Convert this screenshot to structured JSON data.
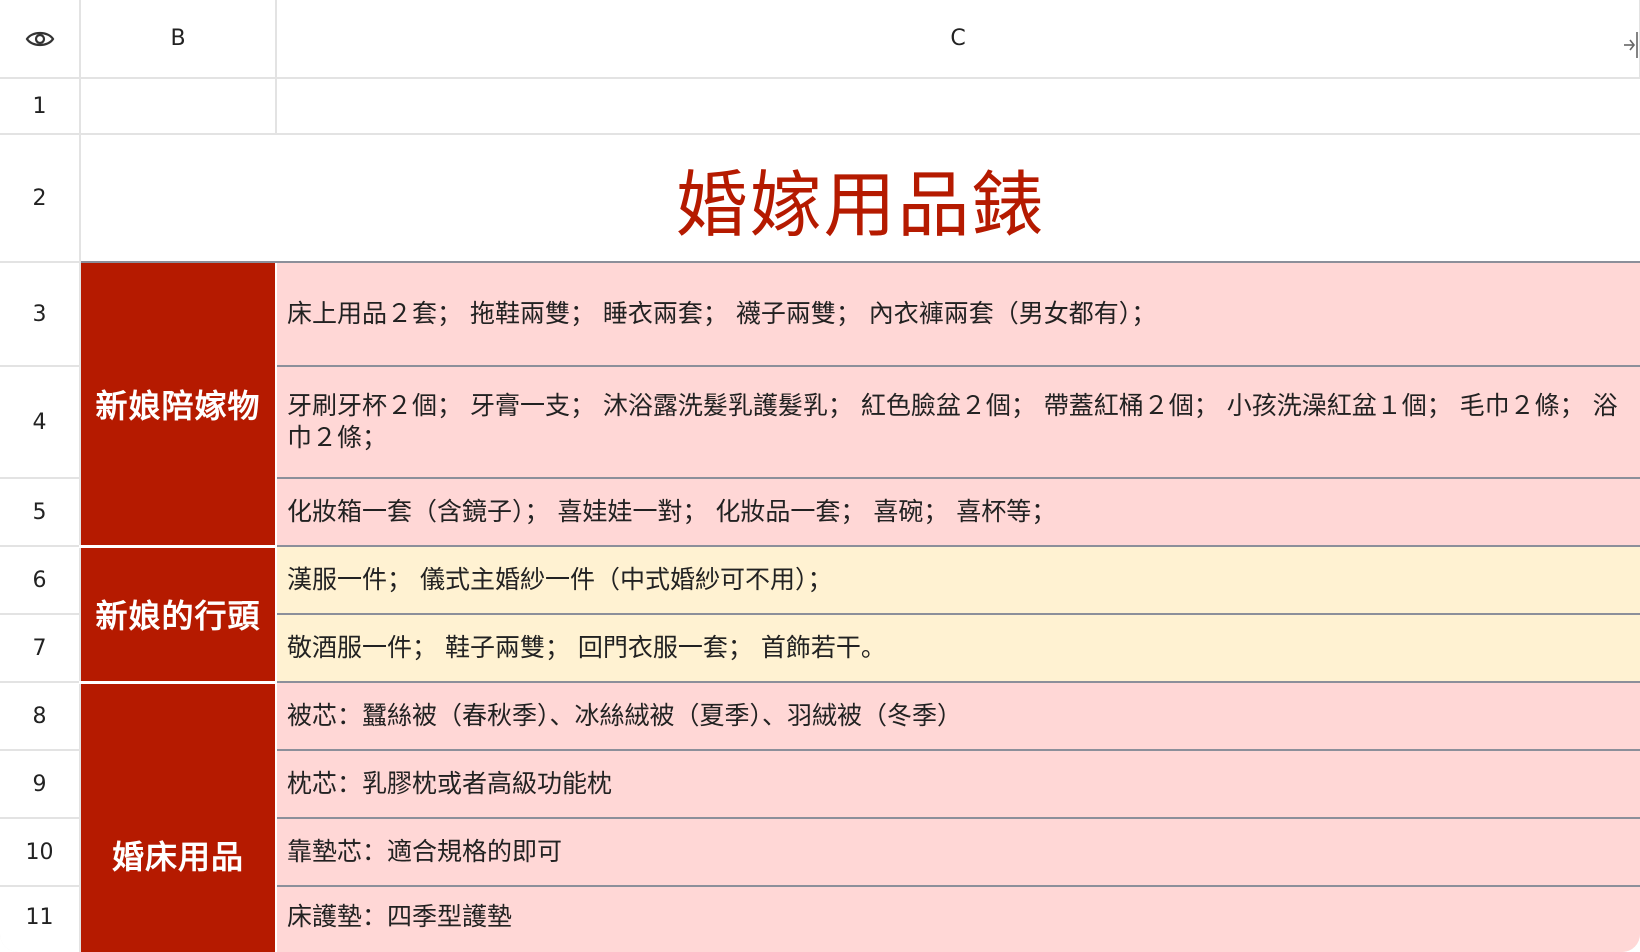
{
  "columns": {
    "corner_icon": "eye-icon",
    "b": "B",
    "c": "C",
    "collapse_icon": "panel-collapse-icon"
  },
  "rows": {
    "r1": "1",
    "r2": "2",
    "r3": "3",
    "r4": "4",
    "r5": "5",
    "r6": "6",
    "r7": "7",
    "r8": "8",
    "r9": "9",
    "r10": "10",
    "r11": "11"
  },
  "title": "婚嫁用品錶",
  "categories": {
    "bride_dowry": "新娘陪嫁物",
    "bride_outfits": "新娘的行頭",
    "wedding_bed": "婚床用品"
  },
  "items": {
    "r3": "床上用品２套；  拖鞋兩雙；  睡衣兩套；  襪子兩雙；  內衣褲兩套（男女都有）；",
    "r4": "牙刷牙杯２個；  牙膏一支；  沐浴露洗髮乳護髮乳；  紅色臉盆２個；  帶蓋紅桶２個；  小孩洗澡紅盆１個；  毛巾２條；  浴巾２條；",
    "r5": "化妝箱一套（含鏡子）；  喜娃娃一對；  化妝品一套；  喜碗；  喜杯等；",
    "r6": "漢服一件；  儀式主婚紗一件（中式婚紗可不用）；",
    "r7": "敬酒服一件；  鞋子兩雙；  回門衣服一套；  首飾若干。",
    "r8": "被芯：蠶絲被（春秋季）、冰絲絨被（夏季）、羽絨被（冬季）",
    "r9": "枕芯：乳膠枕或者高級功能枕",
    "r10": "靠墊芯：適合規格的即可",
    "r11": "床護墊：四季型護墊"
  },
  "colors": {
    "category_bg": "#b51a00",
    "title_text": "#b51a00",
    "pink_row": "#ffd7d6",
    "cream_row": "#fff2d2"
  }
}
